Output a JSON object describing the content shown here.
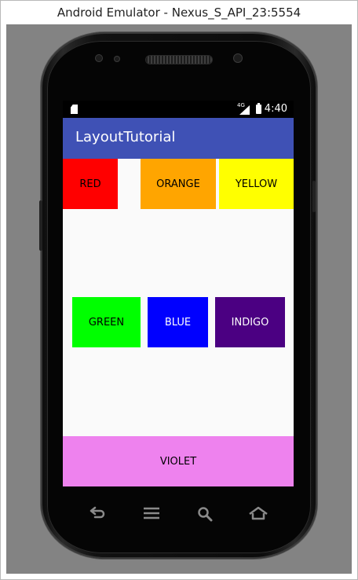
{
  "window": {
    "title": "Android Emulator - Nexus_S_API_23:5554"
  },
  "status_bar": {
    "time": "4:40",
    "network": "4G",
    "icons": [
      "sd-card-icon",
      "signal-icon",
      "battery-icon"
    ]
  },
  "app_bar": {
    "title": "LayoutTutorial",
    "color": "#3f51b5"
  },
  "colors": {
    "red": "#ff0000",
    "orange": "#ffa500",
    "yellow": "#ffff00",
    "green": "#00ff00",
    "blue": "#0000ff",
    "indigo": "#4b0082",
    "violet": "#ee82ee"
  },
  "boxes": {
    "red": "RED",
    "orange": "ORANGE",
    "yellow": "YELLOW",
    "green": "GREEN",
    "blue": "BLUE",
    "indigo": "INDIGO",
    "violet": "VIOLET"
  },
  "nav_buttons": [
    "back-icon",
    "menu-icon",
    "search-icon",
    "home-icon"
  ]
}
